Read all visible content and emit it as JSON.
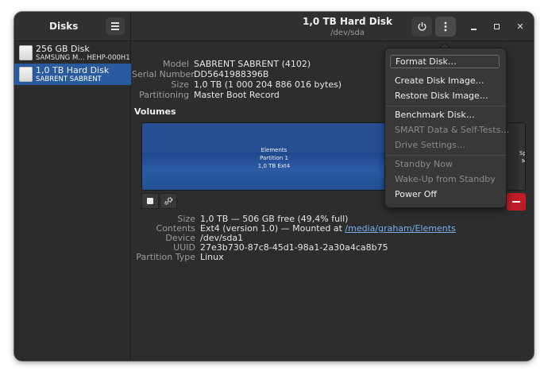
{
  "app": {
    "title": "Disks"
  },
  "header": {
    "title": "1,0 TB Hard Disk",
    "subtitle": "/dev/sda"
  },
  "sidebar": {
    "items": [
      {
        "name": "256 GB Disk",
        "model": "SAMSUNG M… HEHP-000H1",
        "selected": false
      },
      {
        "name": "1,0 TB Hard Disk",
        "model": "SABRENT SABRENT",
        "selected": true
      }
    ]
  },
  "drive_info": {
    "model_label": "Model",
    "model": "SABRENT SABRENT (4102)",
    "serial_label": "Serial Number",
    "serial": "DD5641988396B",
    "size_label": "Size",
    "size": "1,0 TB (1 000 204 886 016 bytes)",
    "partitioning_label": "Partitioning",
    "partitioning": "Master Boot Record"
  },
  "volumes": {
    "title": "Volumes",
    "partition": {
      "name": "Elements",
      "number": "Partition 1",
      "desc": "1,0 TB Ext4"
    },
    "free_space": {
      "line1": "Space",
      "line2": "MB"
    }
  },
  "partition_info": {
    "size_label": "Size",
    "size": "1,0 TB — 506 GB free (49,4% full)",
    "contents_label": "Contents",
    "contents_prefix": "Ext4 (version 1.0) — Mounted at ",
    "mount_link": "/media/graham/Elements",
    "device_label": "Device",
    "device": "/dev/sda1",
    "uuid_label": "UUID",
    "uuid": "27e3b730-87c8-45d1-98a1-2a30a4ca8b75",
    "type_label": "Partition Type",
    "type": "Linux"
  },
  "menu": {
    "items": [
      {
        "label": "Format Disk…"
      },
      {
        "label": "Create Disk Image…"
      },
      {
        "label": "Restore Disk Image…"
      },
      {
        "label": "Benchmark Disk…"
      },
      {
        "label": "SMART Data & Self-Tests…"
      },
      {
        "label": "Drive Settings…"
      },
      {
        "label": "Standby Now"
      },
      {
        "label": "Wake-Up from Standby"
      },
      {
        "label": "Power Off"
      }
    ]
  },
  "icons": {
    "hamburger": "hamburger-menu-icon",
    "power": "power-icon",
    "kebab": "kebab-menu-icon",
    "minimize": "minimize-icon",
    "maximize": "maximize-icon",
    "close": "close-icon",
    "stop": "stop-icon",
    "gears": "gears-icon",
    "remove": "minus-icon"
  },
  "colors": {
    "accent": "#2a5a9e",
    "partition": "#264f94",
    "danger": "#c01c28",
    "link": "#78aeed"
  }
}
